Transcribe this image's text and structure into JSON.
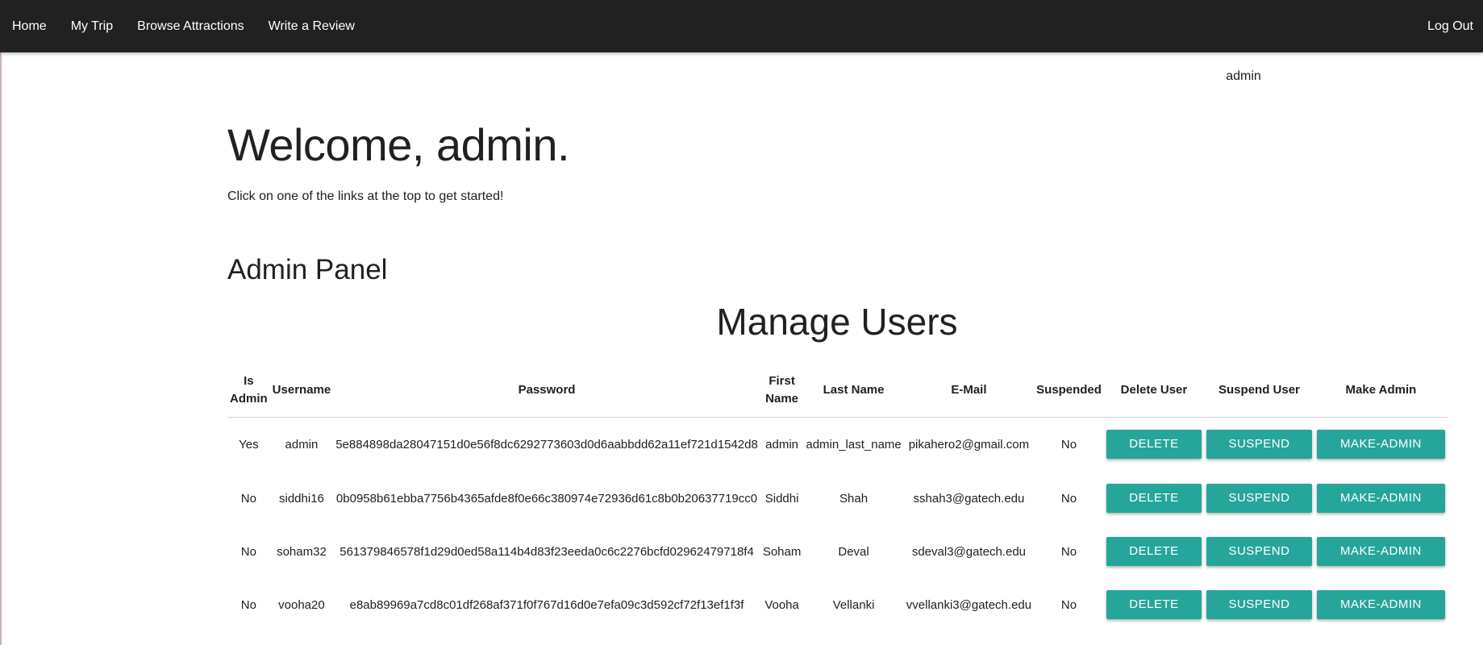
{
  "nav": {
    "links": [
      "Home",
      "My Trip",
      "Browse Attractions",
      "Write a Review"
    ],
    "logout": "Log Out"
  },
  "user_tag": "admin",
  "welcome": "Welcome, admin.",
  "subtitle": "Click on one of the links at the top to get started!",
  "panel_title": "Admin Panel",
  "manage_title": "Manage Users",
  "table": {
    "headers": [
      "Is Admin",
      "Username",
      "Password",
      "First Name",
      "Last Name",
      "E-Mail",
      "Suspended",
      "Delete User",
      "Suspend User",
      "Make Admin"
    ],
    "button_labels": {
      "delete": "DELETE",
      "suspend": "SUSPEND",
      "make_admin": "MAKE-ADMIN"
    },
    "rows": [
      {
        "is_admin": "Yes",
        "username": "admin",
        "password": "5e884898da28047151d0e56f8dc6292773603d0d6aabbdd62a11ef721d1542d8",
        "first_name": "admin",
        "last_name": "admin_last_name",
        "email": "pikahero2@gmail.com",
        "suspended": "No"
      },
      {
        "is_admin": "No",
        "username": "siddhi16",
        "password": "0b0958b61ebba7756b4365afde8f0e66c380974e72936d61c8b0b20637719cc0",
        "first_name": "Siddhi",
        "last_name": "Shah",
        "email": "sshah3@gatech.edu",
        "suspended": "No"
      },
      {
        "is_admin": "No",
        "username": "soham32",
        "password": "561379846578f1d29d0ed58a114b4d83f23eeda0c6c2276bcfd02962479718f4",
        "first_name": "Soham",
        "last_name": "Deval",
        "email": "sdeval3@gatech.edu",
        "suspended": "No"
      },
      {
        "is_admin": "No",
        "username": "vooha20",
        "password": "e8ab89969a7cd8c01df268af371f0f767d16d0e7efa09c3d592cf72f13ef1f3f",
        "first_name": "Vooha",
        "last_name": "Vellanki",
        "email": "vvellanki3@gatech.edu",
        "suspended": "No"
      }
    ]
  },
  "colors": {
    "navbar": "#212121",
    "button": "#26a69a"
  }
}
